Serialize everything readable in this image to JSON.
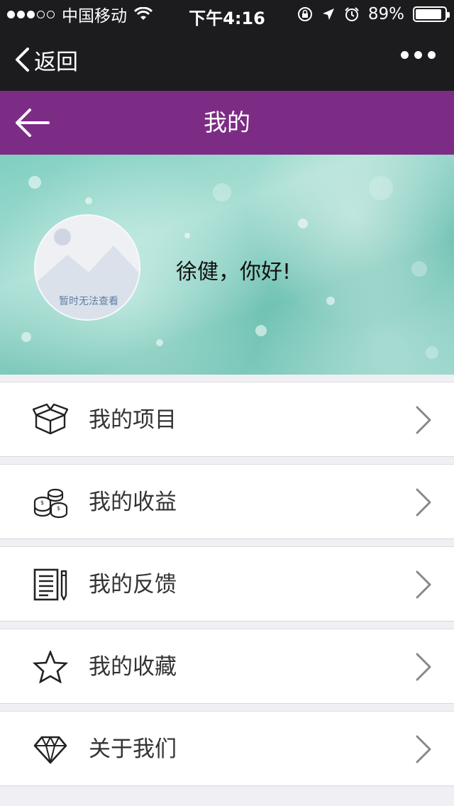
{
  "status_bar": {
    "carrier": "中国移动",
    "time": "下午4:16",
    "battery": "89%",
    "battery_level": 0.89,
    "signal_dots_filled": 3,
    "signal_dots_total": 5
  },
  "wechat_nav": {
    "back_label": "返回"
  },
  "title_bar": {
    "title": "我的",
    "color": "#7d2c85"
  },
  "profile": {
    "avatar_placeholder": "暂时无法查看",
    "greeting": "徐健，你好!"
  },
  "menu": {
    "items": [
      {
        "label": "我的项目",
        "icon": "box-icon"
      },
      {
        "label": "我的收益",
        "icon": "coins-icon"
      },
      {
        "label": "我的反馈",
        "icon": "document-pen-icon"
      },
      {
        "label": "我的收藏",
        "icon": "star-icon"
      },
      {
        "label": "关于我们",
        "icon": "diamond-icon"
      }
    ]
  }
}
